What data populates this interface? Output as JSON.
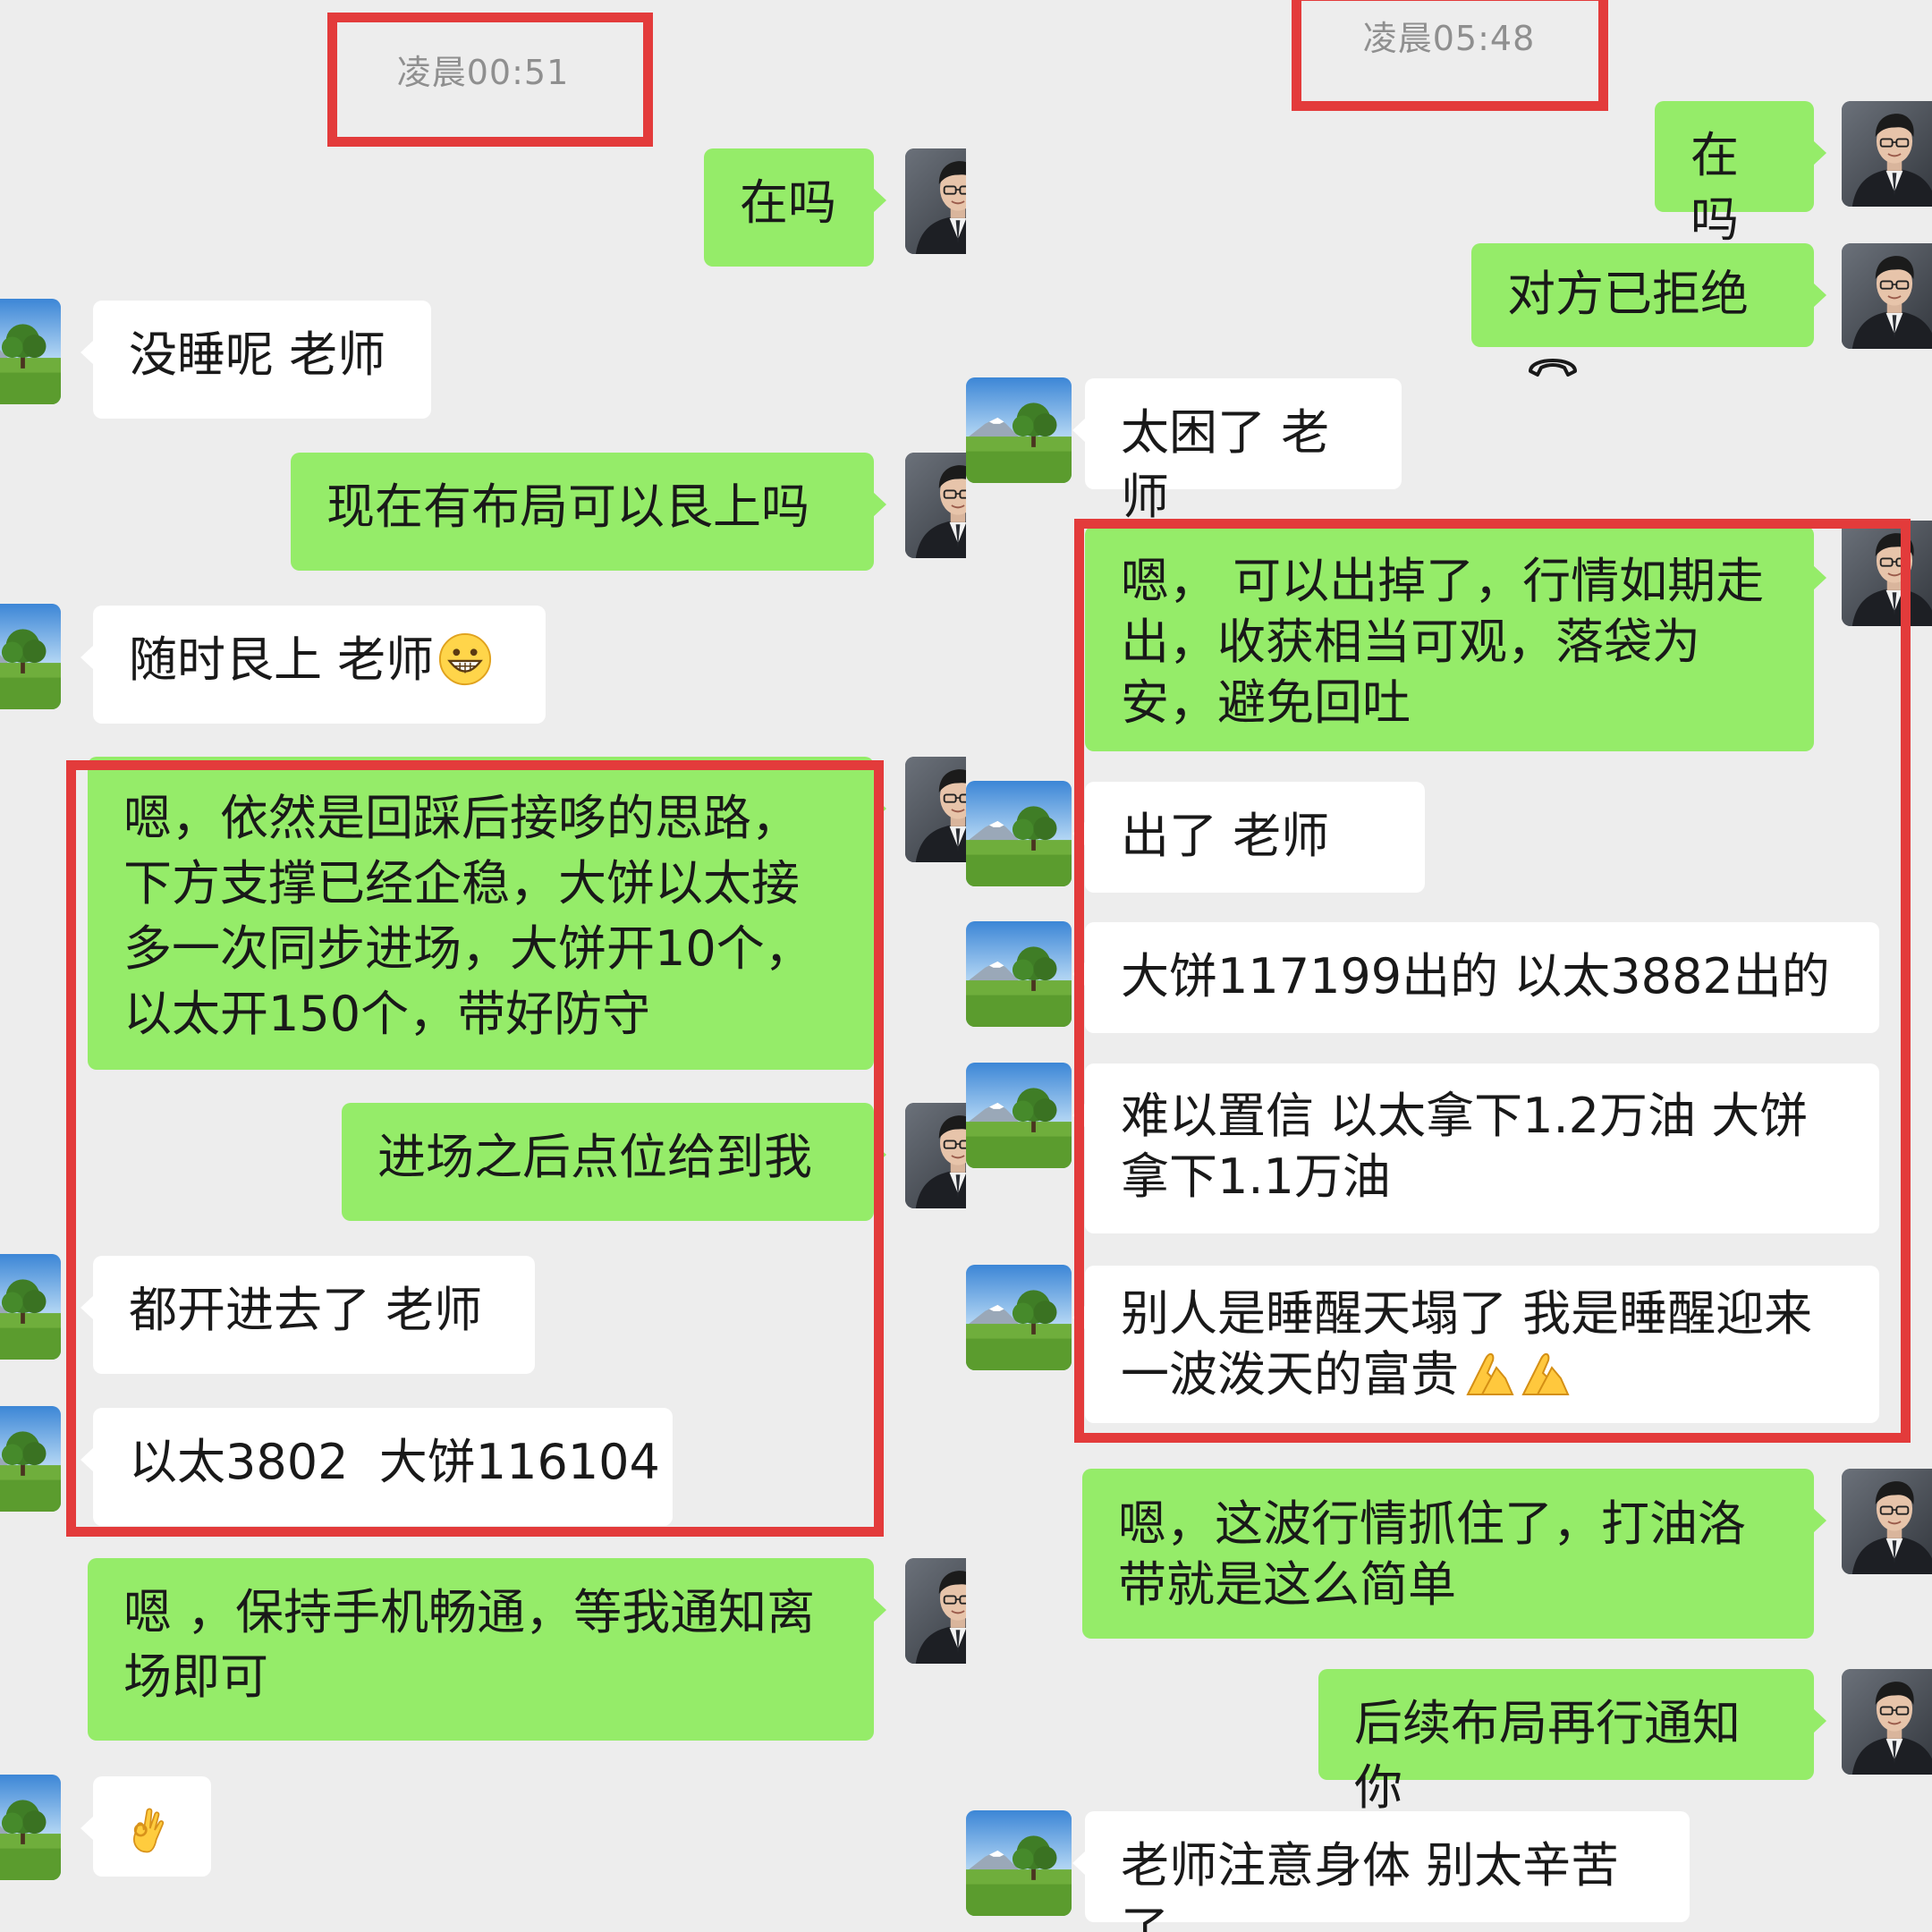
{
  "left": {
    "timestamp": "凌晨00:51",
    "messages": [
      {
        "from": "me",
        "text": "在吗"
      },
      {
        "from": "them",
        "text": "没睡呢 老师"
      },
      {
        "from": "me",
        "text": "现在有布局可以艮上吗"
      },
      {
        "from": "them",
        "text": "随时艮上 老师",
        "emoji": "grinning-face-icon"
      },
      {
        "from": "me",
        "text": "嗯，依然是回踩后接哆的思路，下方支撑已经企稳，大饼以太接多一次同步进场，大饼开10个，以太开150个，带好防守"
      },
      {
        "from": "me",
        "text": "进场之后点位给到我"
      },
      {
        "from": "them",
        "text": "都开进去了 老师"
      },
      {
        "from": "them",
        "text": "以太3802  大饼116104"
      },
      {
        "from": "me",
        "text": "嗯 ，保持手机畅通，等我通知离场即可"
      },
      {
        "from": "them",
        "text": "",
        "emoji": "ok-hand-icon"
      }
    ]
  },
  "right": {
    "timestamp": "凌晨05:48",
    "messages": [
      {
        "from": "me",
        "text": "在吗"
      },
      {
        "from": "me",
        "text": "对方已拒绝",
        "icon": "hang-up-phone-icon"
      },
      {
        "from": "them",
        "text": "太困了 老师"
      },
      {
        "from": "me",
        "text": "嗯， 可以出掉了，行情如期走出，收获相当可观，落袋为安，避免回吐"
      },
      {
        "from": "them",
        "text": "出了 老师"
      },
      {
        "from": "them",
        "text": "大饼117199出的 以太3882出的"
      },
      {
        "from": "them",
        "text": "难以置信 以太拿下1.2万油 大饼拿下1.1万油"
      },
      {
        "from": "them",
        "text": "别人是睡醒天塌了 我是睡醒迎来一波泼天的富贵",
        "emoji": "palms-together-icon"
      },
      {
        "from": "me",
        "text": "嗯，这波行情抓住了，打油洛带就是这么简单"
      },
      {
        "from": "me",
        "text": "后续布局再行通知你"
      },
      {
        "from": "them",
        "text": "老师注意身体 别太辛苦了"
      }
    ]
  },
  "colors": {
    "background": "#ededed",
    "my_bubble": "#95ec69",
    "their_bubble": "#ffffff",
    "highlight": "#e33b3b",
    "timestamp_text": "#8f8f8f"
  }
}
